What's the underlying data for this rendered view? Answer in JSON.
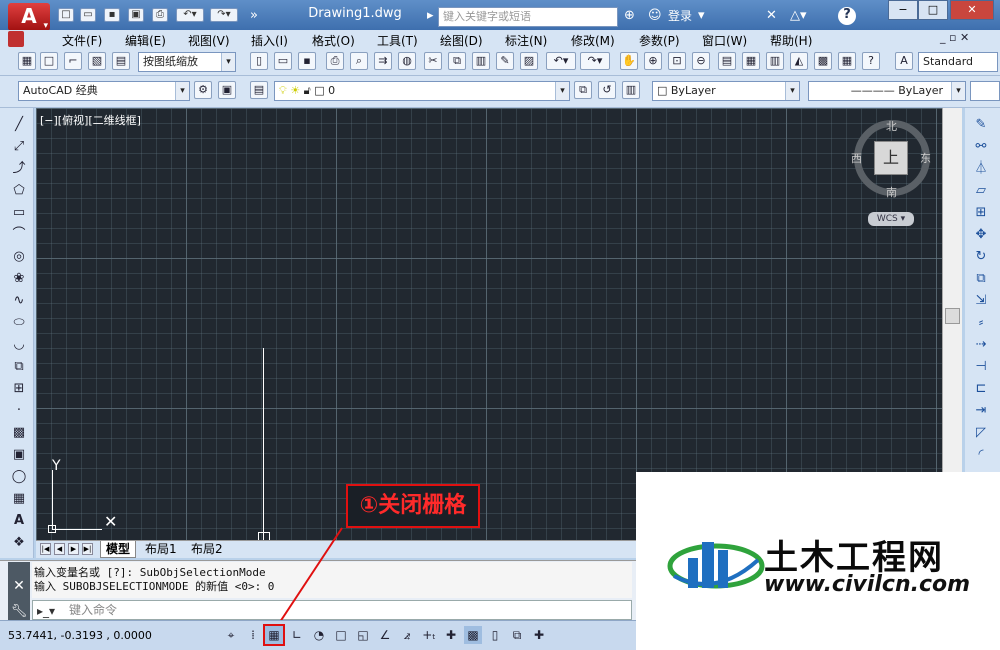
{
  "titlebar": {
    "app_logo": "A",
    "doc_title": "Drawing1.dwg",
    "search_placeholder": "键入关键字或短语",
    "login": "登录",
    "help_icon": "?"
  },
  "menu": {
    "items": [
      "文件(F)",
      "编辑(E)",
      "视图(V)",
      "插入(I)",
      "格式(O)",
      "工具(T)",
      "绘图(D)",
      "标注(N)",
      "修改(M)",
      "参数(P)",
      "窗口(W)",
      "帮助(H)"
    ]
  },
  "toolbar": {
    "zoom_combo": "按图纸缩放",
    "text_style": "Standard",
    "workspace": "AutoCAD 经典",
    "layer_value": "0",
    "color_value": "ByLayer",
    "linetype_value": "ByLayer"
  },
  "viewport": {
    "label": "[−][俯视][二维线框]",
    "compass_n": "北",
    "compass_s": "南",
    "compass_e": "东",
    "compass_w": "西",
    "cube_face": "上",
    "wcs": "WCS",
    "ucs_y": "Y"
  },
  "layout_tabs": [
    "模型",
    "布局1",
    "布局2"
  ],
  "command": {
    "history": [
      "输入变量名或 [?]: SubObjSelectionMode",
      "输入 SUBOBJSELECTIONMODE 的新值 <0>: 0"
    ],
    "placeholder": "键入命令"
  },
  "status": {
    "coords": "53.7441,  -0.3193 , 0.0000"
  },
  "annotation": {
    "text": "①关闭栅格",
    "color": "#e01010"
  },
  "watermark": {
    "title": "土木工程网",
    "url": "www.civilcn.com"
  }
}
